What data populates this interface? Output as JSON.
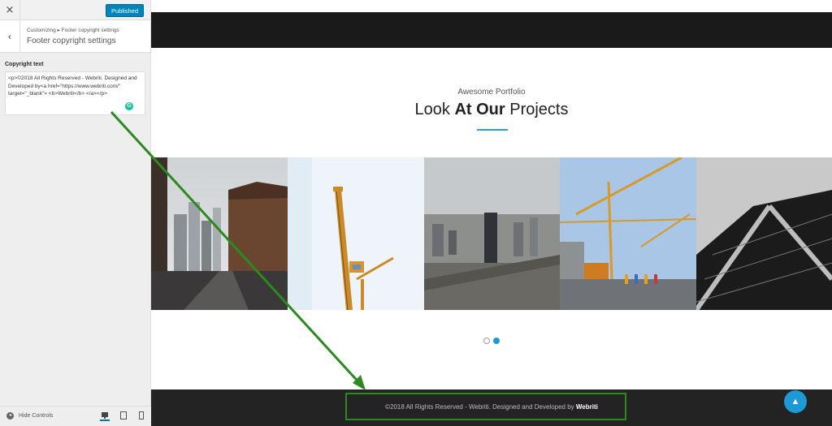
{
  "sidebar": {
    "close_icon": "×",
    "publish_label": "Published",
    "back_icon": "‹",
    "breadcrumb": "Customizing ▸ Footer copyright settings",
    "section_title": "Footer copyright settings",
    "field_label": "Copyright text",
    "field_value": "<p>©2018 All Rights Reserved - Webriti. Designed and Developed by<a href=\"https://www.webriti.com/\" target=\"_blank\"> <b>Webriti</b> </a></p>",
    "grammarly_icon": "G",
    "hide_controls_label": "Hide Controls",
    "device_icons": [
      "desktop-icon",
      "tablet-icon",
      "mobile-icon"
    ]
  },
  "preview": {
    "portfolio_subtitle": "Awesome Portfolio",
    "headline_pre": "Look ",
    "headline_bold": "At Our",
    "headline_post": " Projects",
    "copyright_text": "©2018 All Rights Reserved - Webriti. Designed and Developed by ",
    "copyright_bold": "Webriti",
    "scroll_top_icon": "▲",
    "slider_dots": 2,
    "active_dot": 2
  },
  "colors": {
    "accent": "#1d9ad6",
    "annotation": "#2b8a1e",
    "dark_band": "#1a1a1a",
    "footer_bg": "#232323",
    "publish_button": "#0085ba"
  }
}
